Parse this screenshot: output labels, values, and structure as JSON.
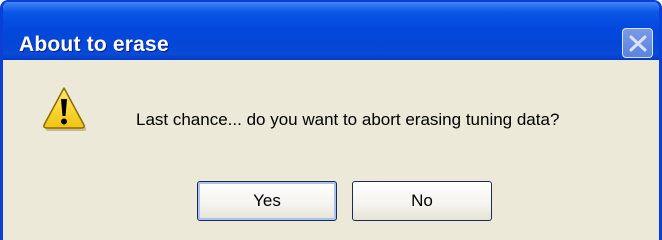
{
  "dialog": {
    "title": "About to erase",
    "message": "Last chance... do you want to abort erasing tuning data?",
    "icon": "warning-icon",
    "buttons": {
      "yes_label": "Yes",
      "no_label": "No"
    },
    "default_button": "Yes"
  },
  "colors": {
    "titlebar": "#0349dd",
    "body": "#ece9d8",
    "icon": "#f7d21b"
  }
}
